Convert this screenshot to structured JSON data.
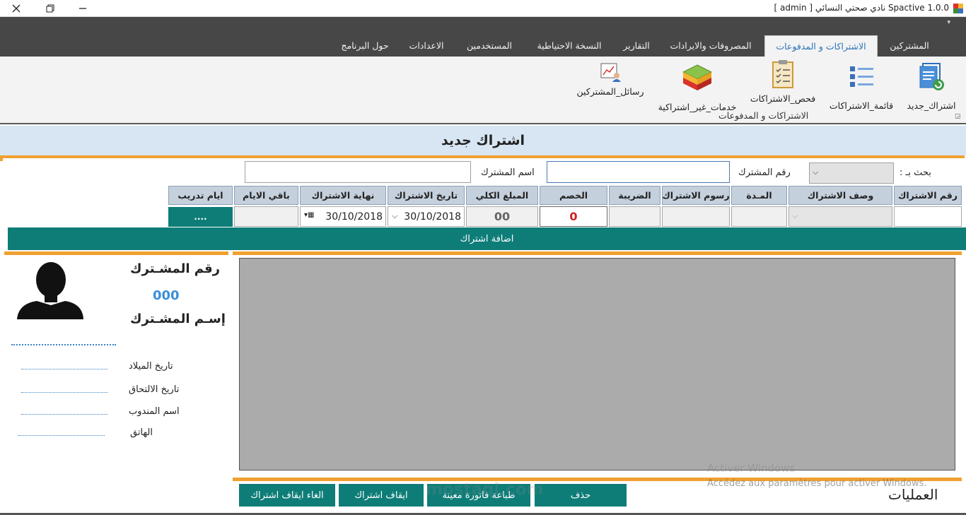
{
  "window": {
    "title": "Spactive 1.0.0 نادي صحتي النسائي  [ admin ]"
  },
  "tabs": [
    "المشتركين",
    "الاشتراكات و المدفوعات",
    "المصروفات والايرادات",
    "التقارير",
    "النسخة الاحتياطية",
    "المستخدمين",
    "الاعدادات",
    "حول البرنامج"
  ],
  "ribbon": {
    "new_subscription": "اشتراك_جديد",
    "subscriptions_list": "قائمة_الاشتراكات",
    "check_subscriptions": "فحص_الاشتراكات",
    "non_sub_services": "خدمات_غير_اشتراكية",
    "member_messages": "رسائل_المشتركين",
    "group_label": "الاشتراكات و المدفوعات"
  },
  "form": {
    "title": "اشتراك جديد",
    "search_by_label": "بحث بـ :",
    "member_number_label": "رقم المشترك",
    "member_name_label": "اسم المشترك",
    "columns": [
      "رقم الاشتراك",
      "وصف الاشتراك",
      "المـدة",
      "رسوم الاشتراك",
      "الضريبة",
      "الخصم",
      "المبلغ الكلي",
      "تاريخ الاشتراك",
      "نهاية الاشتراك",
      "باقي الايام",
      "ايام تدريب"
    ],
    "discount_value": "0",
    "total_value": "00",
    "start_date": "30/10/2018",
    "end_date": "30/10/2018",
    "training_days_button": "....",
    "add_subscription_button": "اضافة اشتراك"
  },
  "member_panel": {
    "number_label": "رقم المشـترك",
    "number_value": "000",
    "name_label": "إسـم المشـترك",
    "fields": [
      "تاريخ الميلاد",
      "تاريخ الالتحاق",
      "اسم المندوب",
      "الهاتق"
    ]
  },
  "operations": {
    "title": "العمليات",
    "delete": "حذف",
    "print_invoice": "طباعة فاتورة معينة",
    "suspend": "ايقاف اشتراك",
    "cancel_suspend": "الغاء ايقاف اشتراك"
  },
  "watermark": {
    "activate_line1": "Activer Windows",
    "activate_line2": "Accédez aux paramètres pour activer Windows.",
    "site": "mostaql.com"
  },
  "colors": {
    "teal": "#0e7d78",
    "orange": "#f0a030",
    "tab_bar": "#474747"
  }
}
